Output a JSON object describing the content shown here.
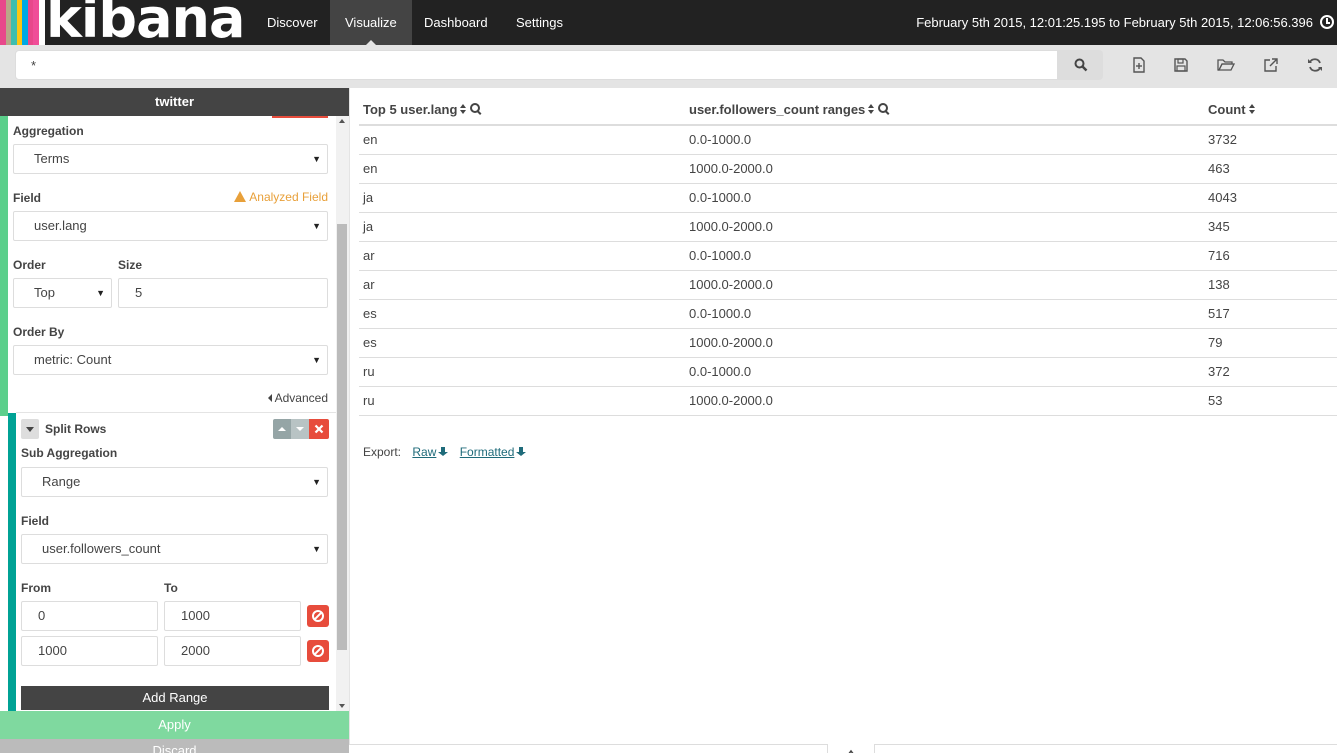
{
  "nav": {
    "brand": "kibana",
    "tabs": [
      {
        "label": "Discover"
      },
      {
        "label": "Visualize"
      },
      {
        "label": "Dashboard"
      },
      {
        "label": "Settings"
      }
    ],
    "active_tab": "Visualize",
    "time_range": "February 5th 2015, 12:01:25.195 to February 5th 2015, 12:06:56.396"
  },
  "search": {
    "query": "*"
  },
  "sidebar": {
    "index": "twitter",
    "aggregation_label": "Aggregation",
    "aggregation_value": "Terms",
    "field_label": "Field",
    "field_warning": "Analyzed Field",
    "field_value": "user.lang",
    "order_label": "Order",
    "order_value": "Top",
    "size_label": "Size",
    "size_value": "5",
    "order_by_label": "Order By",
    "order_by_value": "metric: Count",
    "advanced_label": "Advanced",
    "split_rows_label": "Split Rows",
    "sub_agg_label": "Sub Aggregation",
    "sub_agg_value": "Range",
    "sub_field_label": "Field",
    "sub_field_value": "user.followers_count",
    "from_label": "From",
    "to_label": "To",
    "ranges": [
      {
        "from": "0",
        "to": "1000"
      },
      {
        "from": "1000",
        "to": "2000"
      }
    ],
    "add_range_label": "Add Range",
    "apply_label": "Apply",
    "discard_label": "Discard"
  },
  "table": {
    "headers": [
      "Top 5 user.lang",
      "user.followers_count ranges",
      "Count"
    ],
    "rows": [
      [
        "en",
        "0.0-1000.0",
        "3732"
      ],
      [
        "en",
        "1000.0-2000.0",
        "463"
      ],
      [
        "ja",
        "0.0-1000.0",
        "4043"
      ],
      [
        "ja",
        "1000.0-2000.0",
        "345"
      ],
      [
        "ar",
        "0.0-1000.0",
        "716"
      ],
      [
        "ar",
        "1000.0-2000.0",
        "138"
      ],
      [
        "es",
        "0.0-1000.0",
        "517"
      ],
      [
        "es",
        "1000.0-2000.0",
        "79"
      ],
      [
        "ru",
        "0.0-1000.0",
        "372"
      ],
      [
        "ru",
        "1000.0-2000.0",
        "53"
      ]
    ]
  },
  "export": {
    "label": "Export:",
    "raw": "Raw",
    "formatted": "Formatted"
  },
  "colors": {
    "nav_bg": "#222222",
    "active_tab": "#444444",
    "apply": "#7fd99f",
    "green_bar": "#5bcf8b",
    "teal_bar": "#00a295",
    "danger": "#e74c3c",
    "warning": "#e8a03a"
  }
}
